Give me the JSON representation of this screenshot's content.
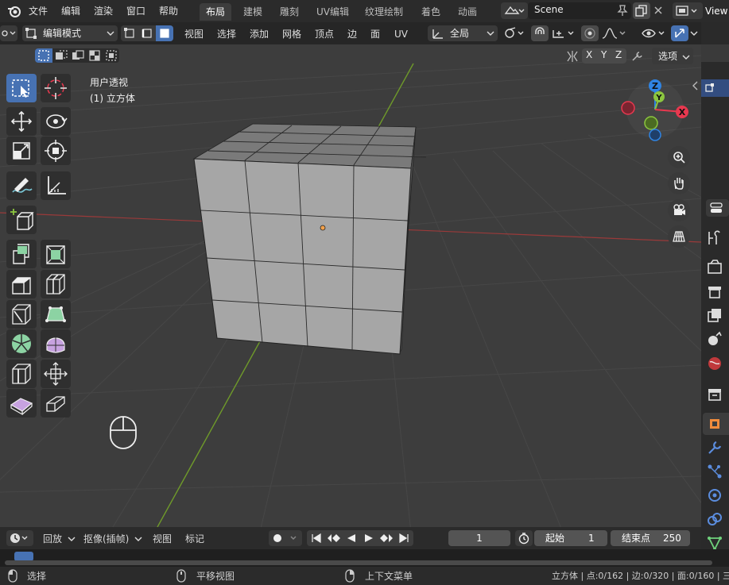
{
  "menubar": {
    "items": [
      "文件",
      "编辑",
      "渲染",
      "窗口",
      "帮助"
    ],
    "workspaces": [
      "布局",
      "建模",
      "雕刻",
      "UV编辑",
      "纹理绘制",
      "着色",
      "动画"
    ],
    "scene_label": "Scene",
    "view_layer_label": "View"
  },
  "header": {
    "mode": "编辑模式",
    "menus": [
      "视图",
      "选择",
      "添加",
      "网格",
      "顶点",
      "边",
      "面",
      "UV"
    ],
    "transform_orientation": "全局",
    "axes": [
      "X",
      "Y",
      "Z"
    ],
    "options_label": "选项"
  },
  "viewport": {
    "view_name": "用户透视",
    "object_name": "(1) 立方体",
    "gizmo_axes": [
      "Z",
      "Y",
      "X"
    ]
  },
  "timeline": {
    "playback": "回放",
    "keying": "抠像(插帧)",
    "view": "视图",
    "marker": "标记",
    "current_frame": "1",
    "start_label": "起始",
    "start_frame": "1",
    "end_label": "结束点",
    "end_frame": "250"
  },
  "status": {
    "select": "选择",
    "pan": "平移视图",
    "context": "上下文菜单",
    "stats": "立方体 | 点:0/162 | 边:0/320 | 面:0/160 | 三"
  },
  "colors": {
    "accent": "#4772b3",
    "x_axis": "#e8384f",
    "y_axis": "#8cc63f",
    "z_axis": "#2f84e3",
    "mesh_face": "#a6a6a6",
    "viewport_bg": "#3d3d3d"
  }
}
